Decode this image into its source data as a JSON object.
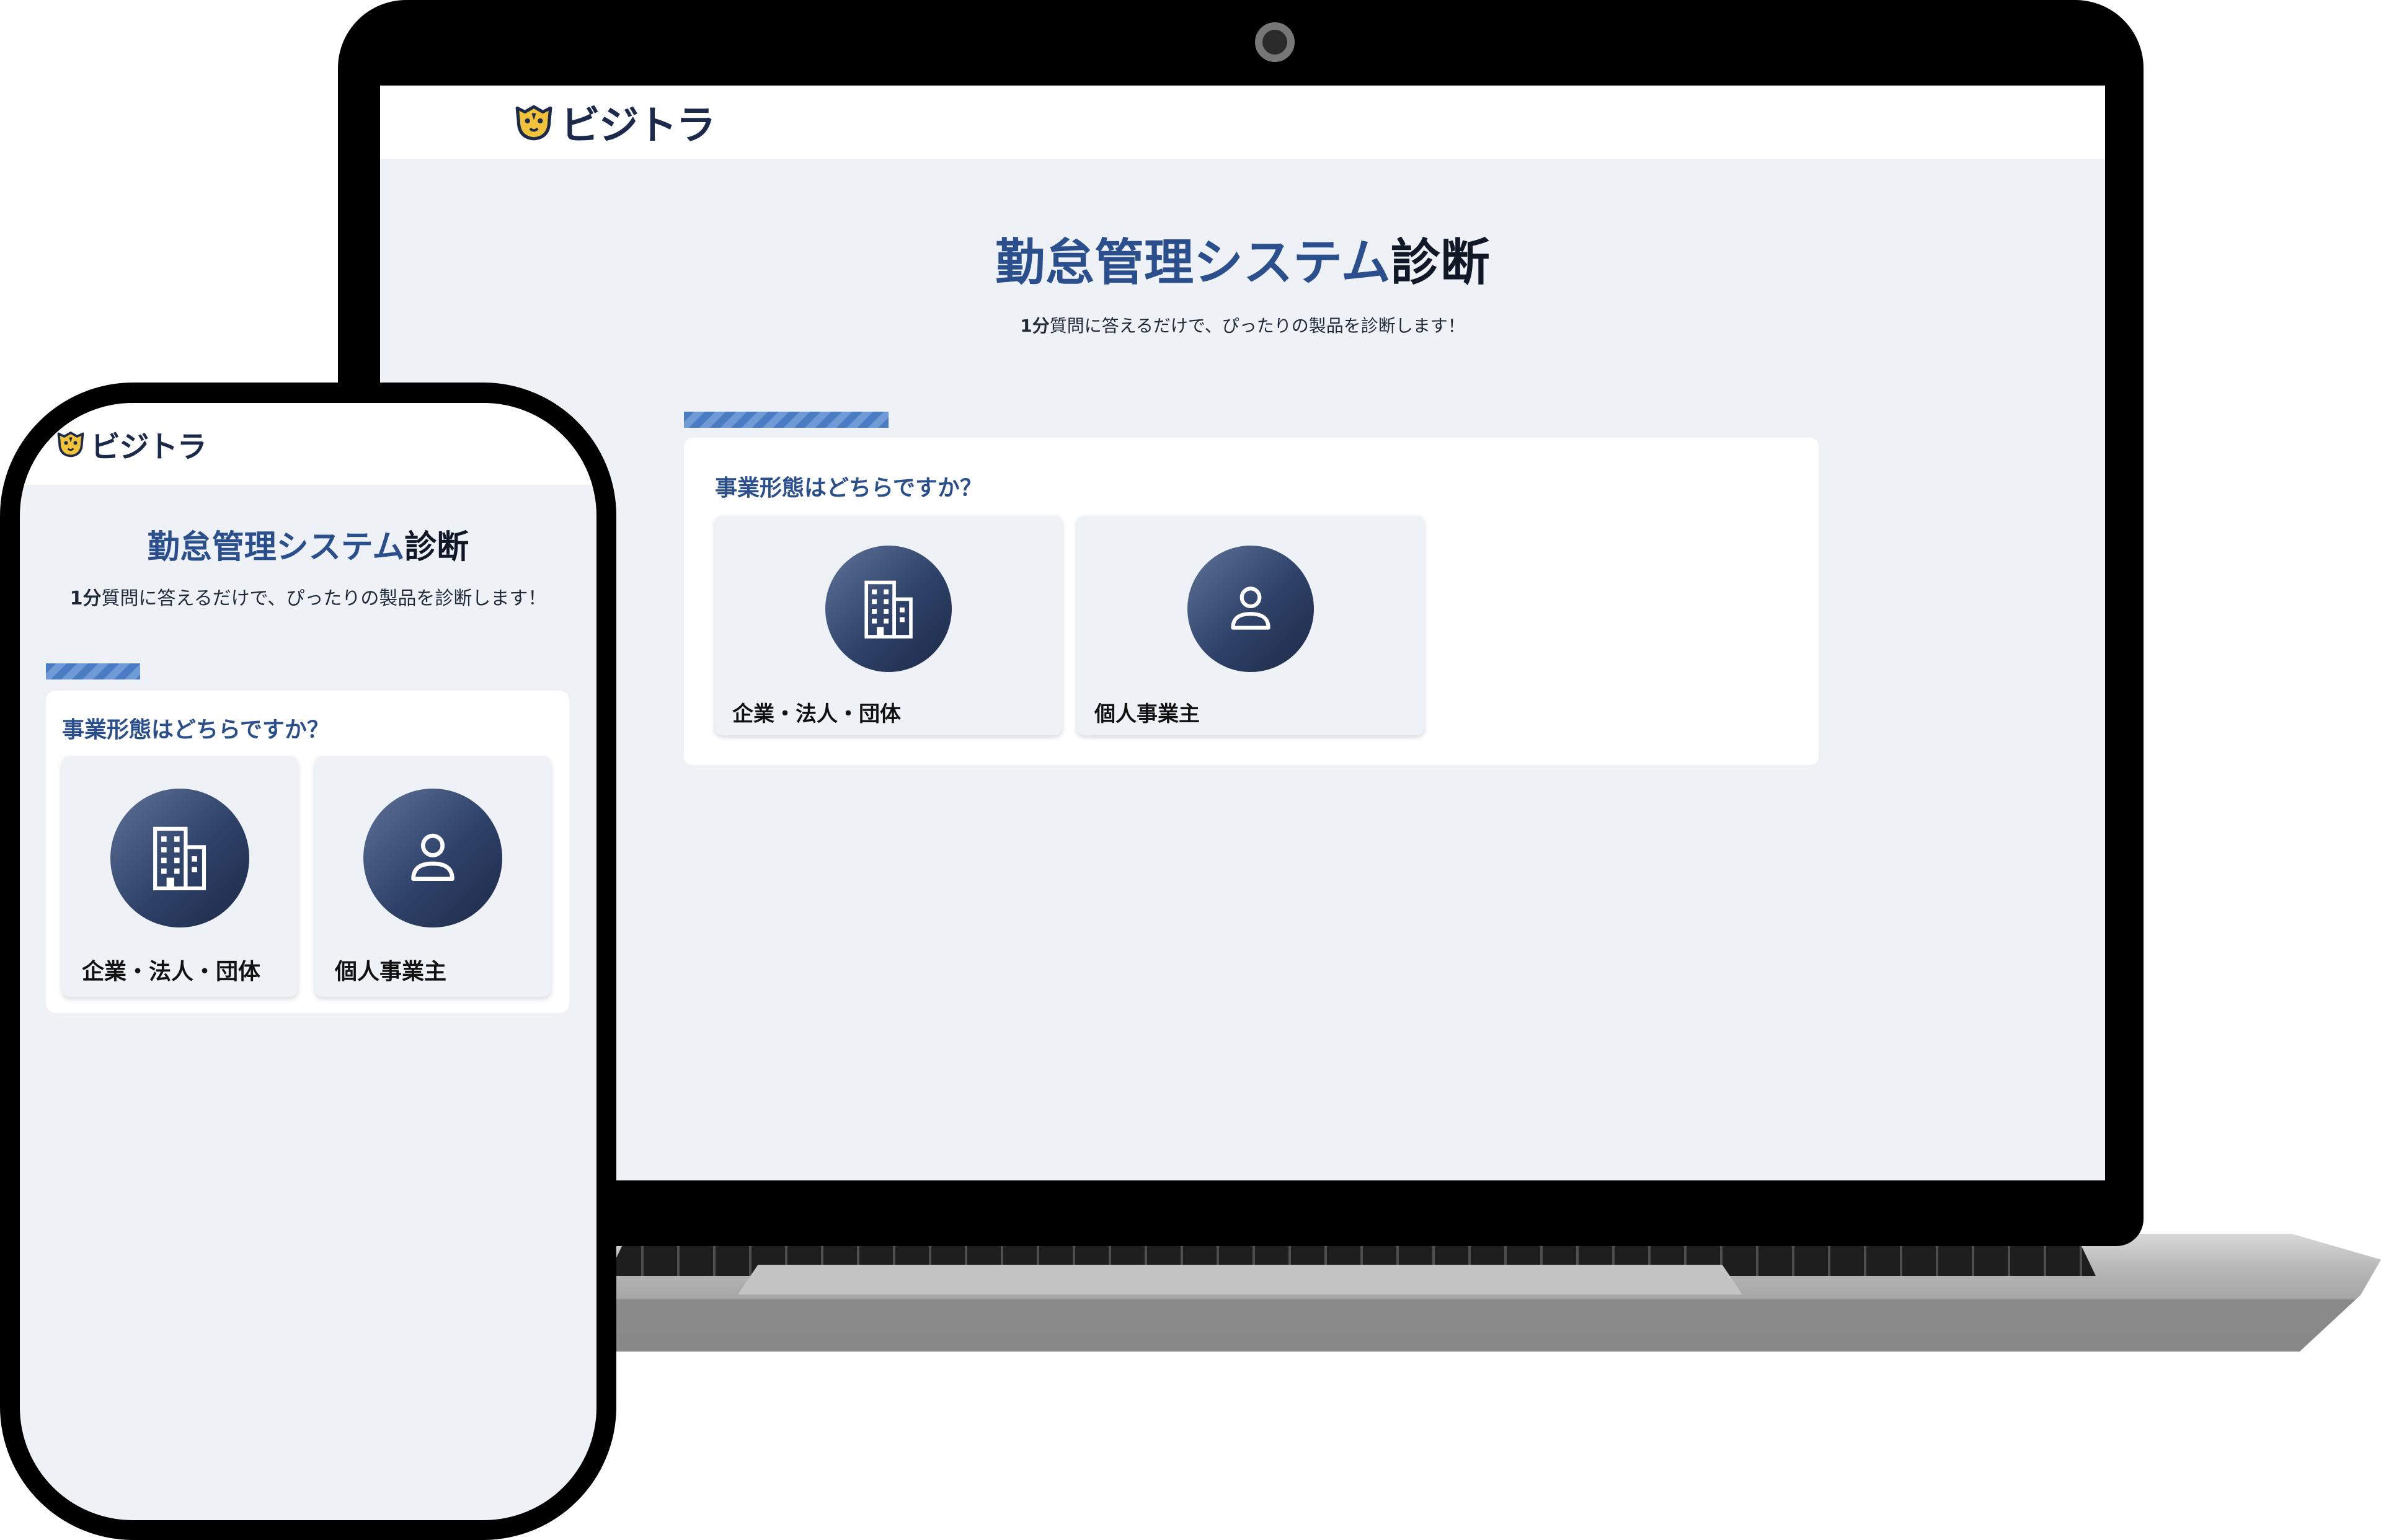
{
  "brand": {
    "name": "ビジトラ"
  },
  "page": {
    "title_main": "勤怠管理システム",
    "title_suffix": "診断",
    "subtitle_bold": "1分",
    "subtitle_rest": "質問に答えるだけで、ぴったりの製品を診断します！"
  },
  "question": {
    "text": "事業形態はどちらですか？",
    "options": [
      {
        "label": "企業・法人・団体",
        "icon": "building-icon"
      },
      {
        "label": "個人事業主",
        "icon": "person-icon"
      }
    ]
  },
  "colors": {
    "title_blue": "#2a4f8c",
    "page_bg": "#eef2f6",
    "progress": "#4a7cc4",
    "icon_circle": "#2e4168"
  }
}
